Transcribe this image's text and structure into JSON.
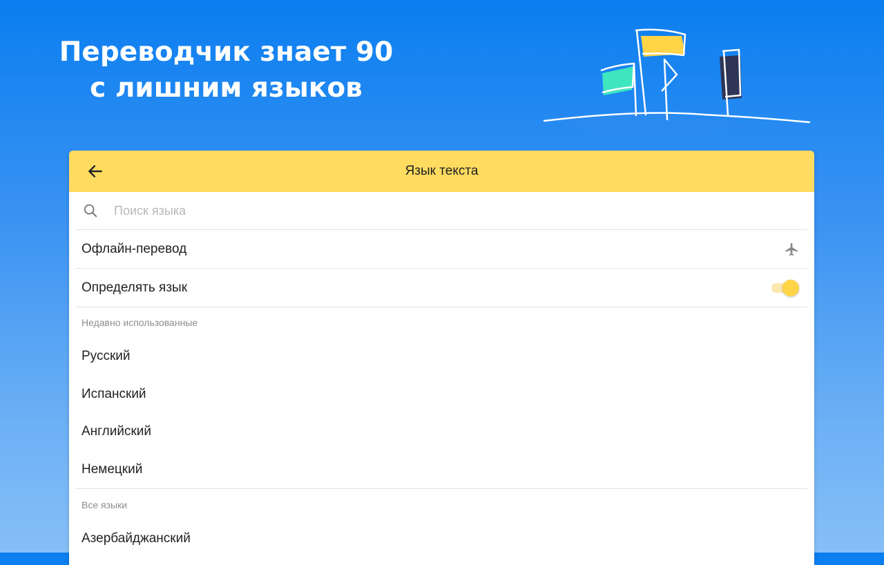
{
  "promo": {
    "title_line1": "Переводчик знает 90",
    "title_line2": "с лишним языков"
  },
  "colors": {
    "background_top": "#0a7ef0",
    "background_bottom": "#86bff7",
    "appbar": "#ffdb60",
    "toggle_on": "#ffd447"
  },
  "appbar": {
    "title": "Язык текста",
    "back_icon": "arrow-left-icon"
  },
  "search": {
    "icon": "search-icon",
    "placeholder": "Поиск языка",
    "value": ""
  },
  "settings": {
    "offline": {
      "label": "Офлайн-перевод",
      "icon": "airplane-icon"
    },
    "detect": {
      "label": "Определять язык",
      "enabled": true
    }
  },
  "recent": {
    "header": "Недавно использованные",
    "items": [
      "Русский",
      "Испанский",
      "Английский",
      "Немецкий"
    ]
  },
  "all": {
    "header": "Все языки",
    "items": [
      "Азербайджанский"
    ]
  }
}
